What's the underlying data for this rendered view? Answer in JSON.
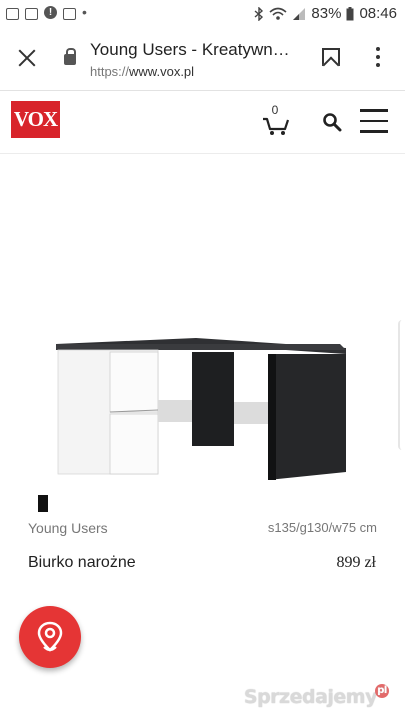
{
  "status_bar": {
    "battery": "83%",
    "time": "08:46"
  },
  "browser": {
    "title": "Young Users - Kreatywn…",
    "url_scheme": "https://",
    "url_host": "www.vox.pl"
  },
  "site": {
    "logo_text": "VOX",
    "cart_count": "0"
  },
  "product": {
    "brand": "Young Users",
    "dimensions": "s135/g130/w75 cm",
    "name": "Biurko narożne",
    "price": "899 zł"
  },
  "watermark": {
    "text": "Sprzedajemy",
    "badge": "pl"
  },
  "colors": {
    "logo_bg": "#d8242b",
    "fab_bg": "#e53535"
  }
}
